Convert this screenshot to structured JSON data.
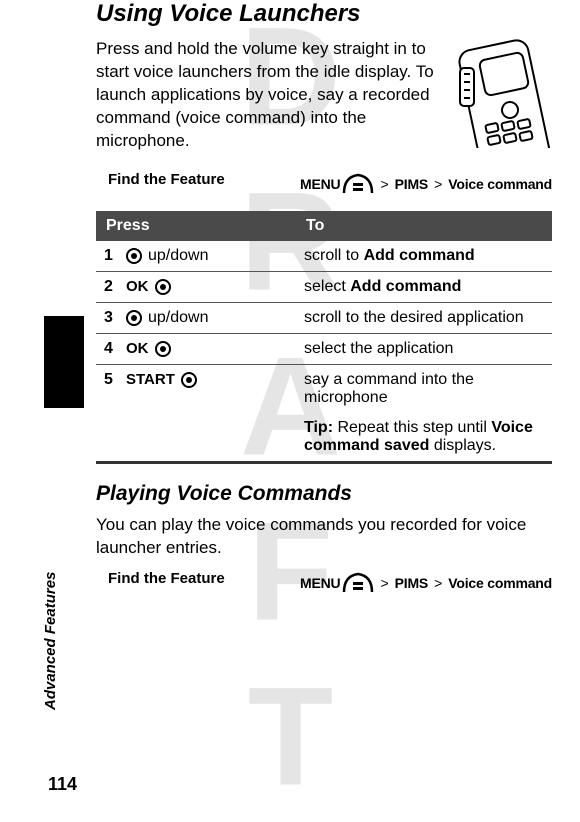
{
  "watermark": "DRAFT",
  "side_label": "Advanced Features",
  "page_number": "114",
  "section1": {
    "title": "Using Voice Launchers",
    "para": "Press and hold the volume key straight in to start voice launchers from the idle display. To launch applications by voice, say a recorded command (voice command) into the microphone.",
    "find_feature": "Find the Feature",
    "path": {
      "menu": "MENU",
      "level1": "PIMS",
      "level2": "Voice command",
      "sep": ">"
    },
    "table": {
      "head_press": "Press",
      "head_to": "To",
      "rows": [
        {
          "n": "1",
          "press_key": "up/down",
          "press_soft": "",
          "to_prefix": "scroll to ",
          "to_bold": "Add command"
        },
        {
          "n": "2",
          "press_key": "",
          "press_soft": "OK",
          "to_prefix": "select ",
          "to_bold": "Add command"
        },
        {
          "n": "3",
          "press_key": "up/down",
          "press_soft": "",
          "to_prefix": "scroll to the desired application",
          "to_bold": ""
        },
        {
          "n": "4",
          "press_key": "",
          "press_soft": "OK",
          "to_prefix": "select the application",
          "to_bold": ""
        },
        {
          "n": "5",
          "press_key": "",
          "press_soft": "START",
          "to_prefix": "say a command into the microphone",
          "to_bold": ""
        }
      ],
      "tip_label": "Tip:",
      "tip_before": " Repeat this step until ",
      "tip_bold": "Voice command saved",
      "tip_after": " displays."
    }
  },
  "section2": {
    "title": "Playing Voice Commands",
    "para": "You can play the voice commands you recorded for voice launcher entries.",
    "find_feature": "Find the Feature",
    "path": {
      "menu": "MENU",
      "level1": "PIMS",
      "level2": "Voice command",
      "sep": ">"
    }
  }
}
